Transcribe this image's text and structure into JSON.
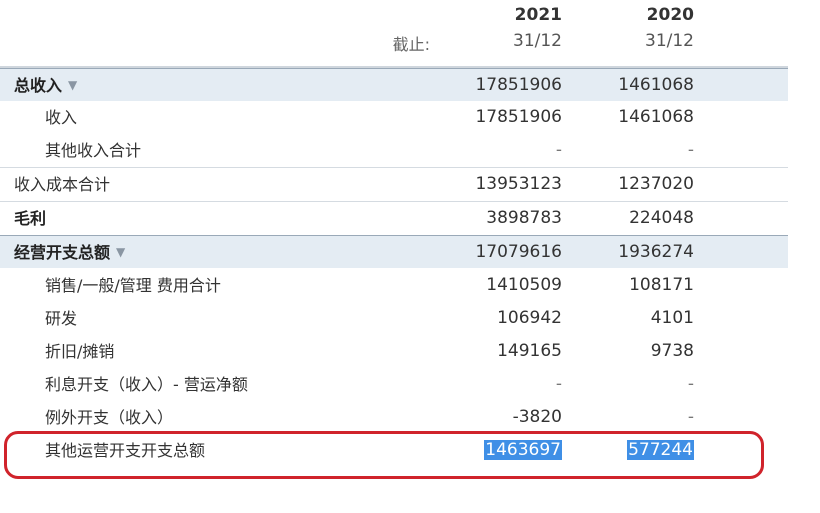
{
  "header": {
    "as_of_label": "截止:",
    "col1_year": "2021",
    "col1_date": "31/12",
    "col2_year": "2020",
    "col2_date": "31/12"
  },
  "rows": [
    {
      "label": "总收入",
      "v1": "17851906",
      "v2": "1461068"
    },
    {
      "label": "收入",
      "v1": "17851906",
      "v2": "1461068"
    },
    {
      "label": "其他收入合计",
      "v1": "-",
      "v2": "-"
    },
    {
      "label": "收入成本合计",
      "v1": "13953123",
      "v2": "1237020"
    },
    {
      "label": "毛利",
      "v1": "3898783",
      "v2": "224048"
    },
    {
      "label": "经营开支总额",
      "v1": "17079616",
      "v2": "1936274"
    },
    {
      "label": "销售/一般/管理 费用合计",
      "v1": "1410509",
      "v2": "108171"
    },
    {
      "label": "研发",
      "v1": "106942",
      "v2": "4101"
    },
    {
      "label": "折旧/摊销",
      "v1": "149165",
      "v2": "9738"
    },
    {
      "label": "利息开支（收入）- 营运净额",
      "v1": "-",
      "v2": "-"
    },
    {
      "label": "例外开支（收入）",
      "v1": "-3820",
      "v2": "-"
    },
    {
      "label": "其他运营开支开支总额",
      "v1": "1463697",
      "v2": "577244"
    }
  ],
  "icons": {
    "expand": "chevron-down-icon"
  },
  "colors": {
    "section_bg": "#e4ecf3",
    "selection": "#3f8fe6",
    "highlight_oval": "#d0232b"
  }
}
